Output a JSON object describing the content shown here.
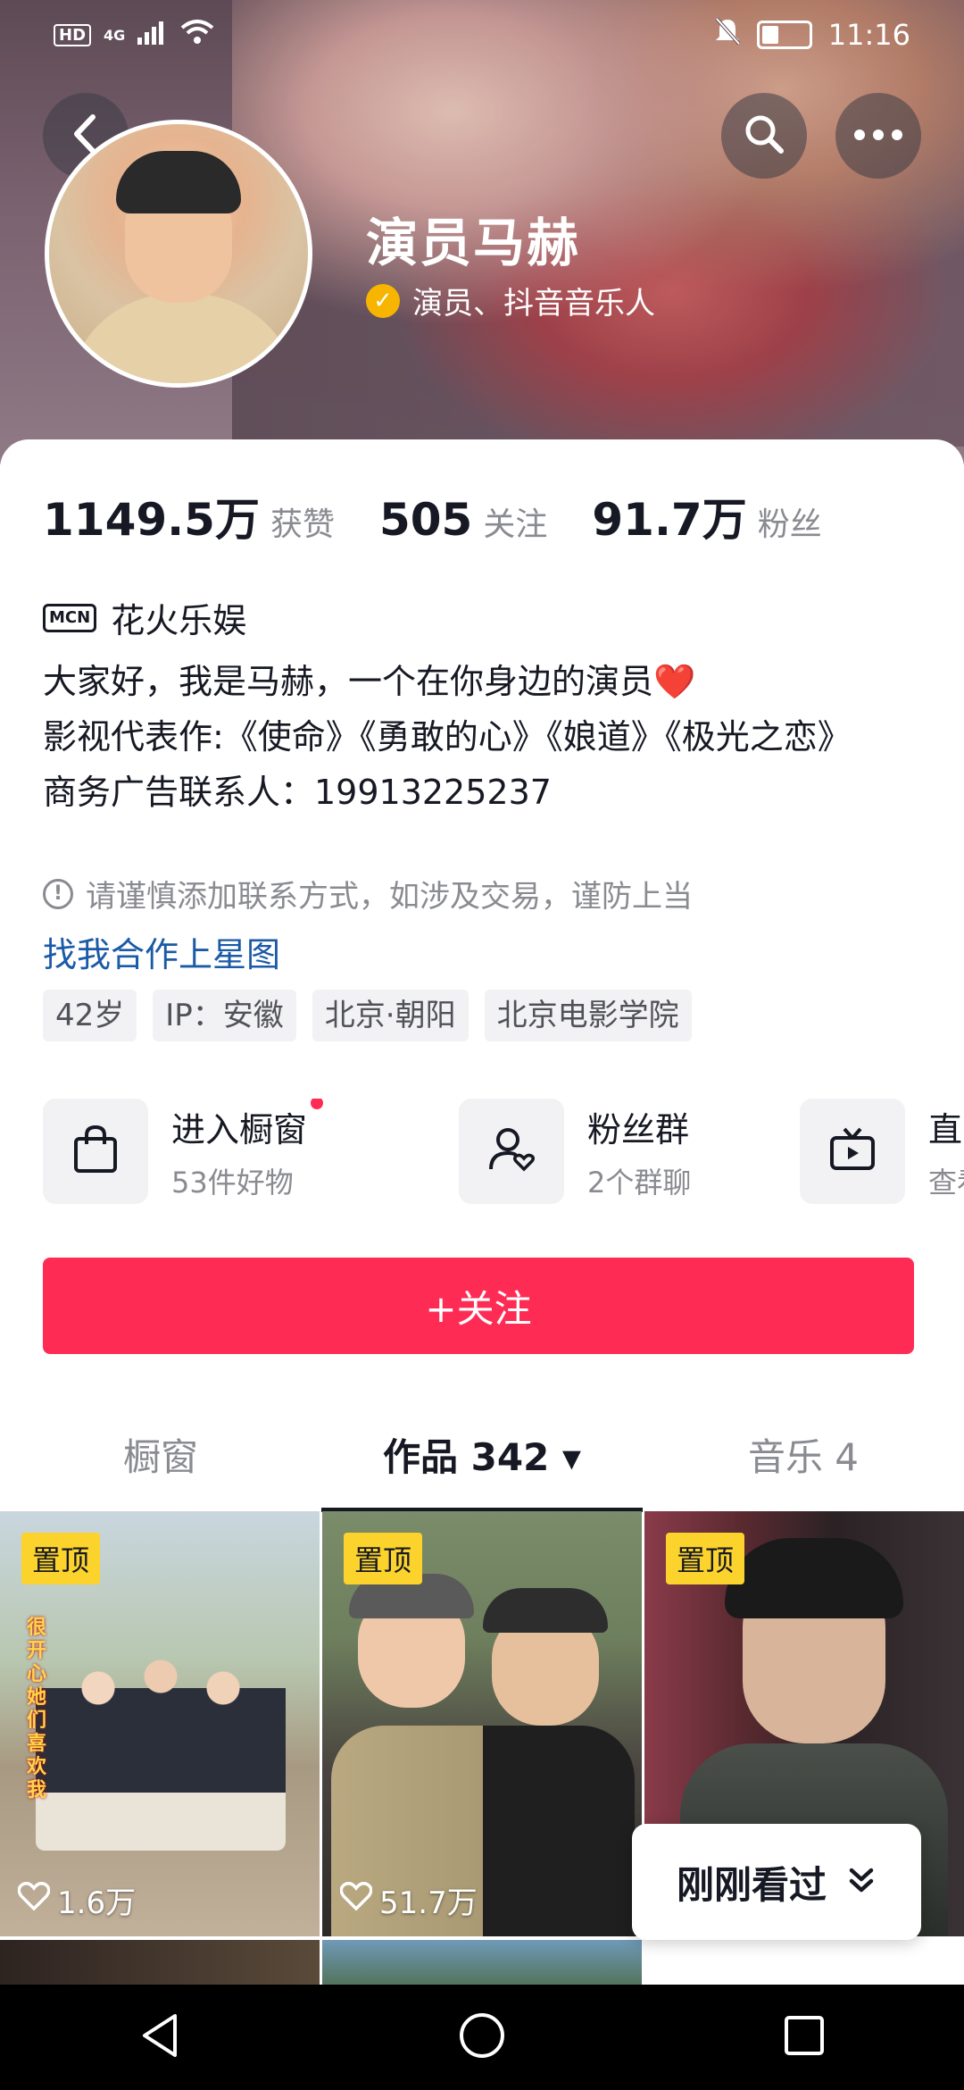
{
  "status_bar": {
    "network_left": "HD",
    "network_gen": "4G",
    "time": "11:16"
  },
  "profile": {
    "name": "演员马赫",
    "verification": "演员、抖音音乐人"
  },
  "stats": [
    {
      "num": "1149.5万",
      "label": "获赞"
    },
    {
      "num": "505",
      "label": "关注"
    },
    {
      "num": "91.7万",
      "label": "粉丝"
    }
  ],
  "mcn": {
    "icon_text": "MCN",
    "label": "花火乐娱"
  },
  "bio": {
    "line1": "大家好，我是马赫，一个在你身边的演员",
    "heart": "❤️",
    "line2": "影视代表作:《使命》《勇敢的心》《娘道》《极光之恋》",
    "line3": "商务广告联系人：19913225237"
  },
  "warning": {
    "icon": "!",
    "text": "请谨慎添加联系方式，如涉及交易，谨防上当"
  },
  "xingtu_link": "找我合作上星图",
  "tags": [
    "42岁",
    "IP：安徽",
    "北京·朝阳",
    "北京电影学院"
  ],
  "services": [
    {
      "title": "进入橱窗",
      "sub": "53件好物",
      "icon": "shopping-bag-icon"
    },
    {
      "title": "粉丝群",
      "sub": "2个群聊",
      "icon": "fan-group-icon"
    },
    {
      "title": "直",
      "sub": "查看",
      "icon": "tv-icon"
    }
  ],
  "follow_button": "+关注",
  "tabs": [
    {
      "label": "橱窗"
    },
    {
      "label": "作品 342 ▾"
    },
    {
      "label": "音乐 4"
    }
  ],
  "videos": [
    {
      "pin": "置顶",
      "likes": "1.6万",
      "overlay": "很开心她们喜欢我"
    },
    {
      "pin": "置顶",
      "likes": "51.7万"
    },
    {
      "pin": "置顶"
    }
  ],
  "recently_viewed": {
    "label": "刚刚看过",
    "icon": "double-chevron-down-icon"
  },
  "colors": {
    "accent": "#fe2c55",
    "link": "#1b5aa6",
    "pin": "#fbd32c"
  }
}
